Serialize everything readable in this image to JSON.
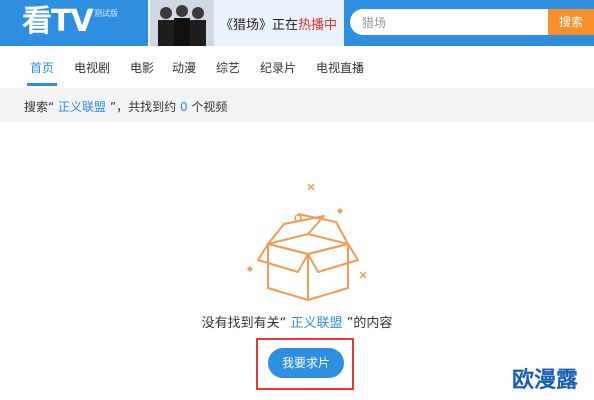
{
  "header": {
    "logo": "看TV",
    "beta": "测试版",
    "banner": {
      "prefix": "《猎场》正在",
      "hot": "热播中"
    },
    "search": {
      "placeholder": "猎场",
      "button": "搜索"
    }
  },
  "nav": {
    "items": [
      "首页",
      "电视剧",
      "电影",
      "动漫",
      "综艺",
      "纪录片",
      "电视直播"
    ],
    "active": "首页"
  },
  "result": {
    "prefix": "搜索“",
    "query": "正义联盟",
    "middle": "”，共找到约",
    "count": "0",
    "suffix": "个视频"
  },
  "empty": {
    "prefix": "没有找到有关“",
    "query": "正义联盟",
    "suffix": "”的内容",
    "button": "我要求片"
  },
  "watermark": "欧漫露",
  "colors": {
    "brand_blue": "#2e8fe0",
    "search_orange": "#f7902b",
    "hot_red": "#e0352b",
    "highlight_red": "#e53935"
  }
}
